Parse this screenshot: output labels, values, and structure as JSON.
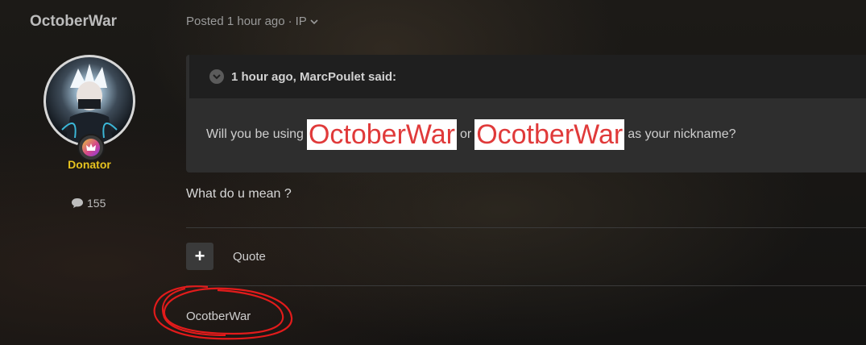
{
  "author": {
    "name": "OctoberWar",
    "group": "Donator",
    "post_count": "155",
    "colors": {
      "group": "#e7c31f"
    }
  },
  "post": {
    "meta": {
      "posted": "Posted 1 hour ago",
      "separator": "·",
      "ip_label": "IP"
    },
    "quote": {
      "citation": "1 hour ago, MarcPoulet said:",
      "text_before": "Will you be using",
      "highlight_1": "OctoberWar",
      "text_middle": "or",
      "highlight_2": "OcotberWar",
      "text_after": "as your nickname?"
    },
    "reply": "What do u mean ?",
    "actions": {
      "plus_label": "+",
      "quote_label": "Quote"
    },
    "signature": "OcotberWar"
  },
  "icons": {
    "comment": "comment-icon",
    "chevron": "chevron-down-icon",
    "badge": "crown-badge-icon"
  },
  "colors": {
    "highlight_text": "#e03a3a",
    "highlight_bg": "#ffffff",
    "scribble": "#e21b1b"
  }
}
